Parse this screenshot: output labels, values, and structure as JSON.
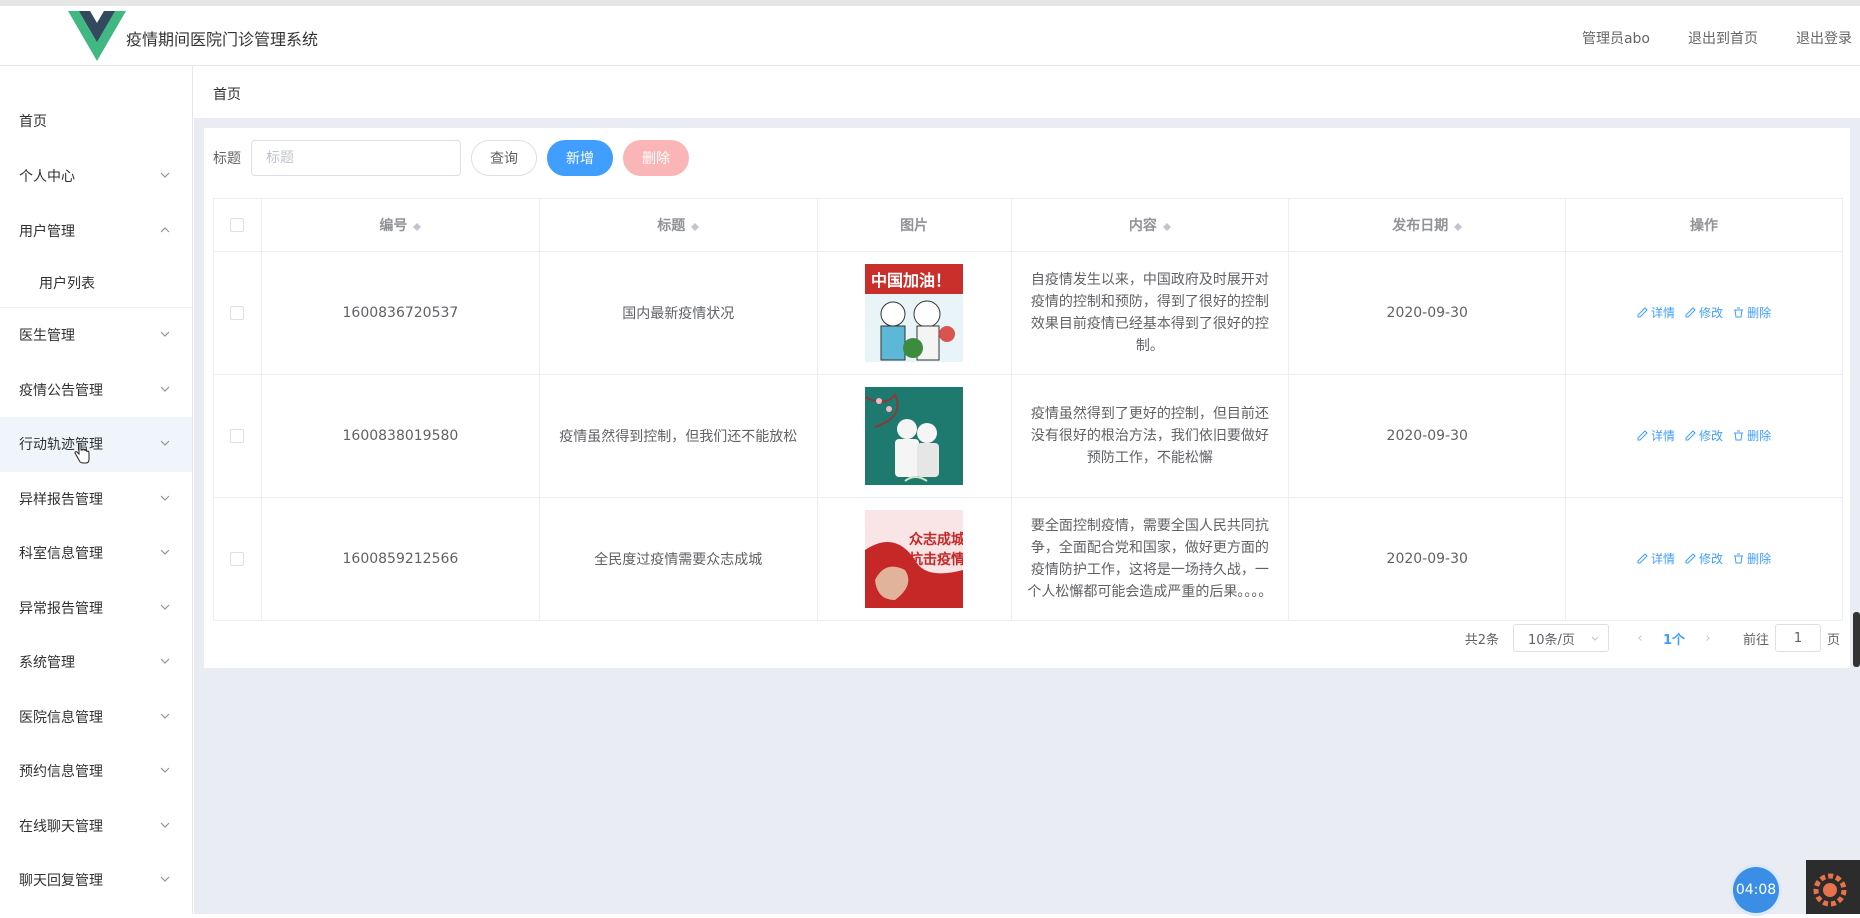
{
  "header": {
    "app_title": "疫情期间医院门诊管理系统",
    "admin_label": "管理员abo",
    "back_home": "退出到首页",
    "logout": "退出登录"
  },
  "sidebar": {
    "items": [
      {
        "label": "首页",
        "expandable": false
      },
      {
        "label": "个人中心",
        "expandable": true
      },
      {
        "label": "用户管理",
        "expandable": true,
        "expanded": true,
        "children": [
          "用户列表"
        ]
      },
      {
        "label": "医生管理",
        "expandable": true
      },
      {
        "label": "疫情公告管理",
        "expandable": true
      },
      {
        "label": "行动轨迹管理",
        "expandable": true,
        "hovered": true
      },
      {
        "label": "异样报告管理",
        "expandable": true
      },
      {
        "label": "科室信息管理",
        "expandable": true
      },
      {
        "label": "异常报告管理",
        "expandable": true
      },
      {
        "label": "系统管理",
        "expandable": true
      },
      {
        "label": "医院信息管理",
        "expandable": true
      },
      {
        "label": "预约信息管理",
        "expandable": true
      },
      {
        "label": "在线聊天管理",
        "expandable": true
      },
      {
        "label": "聊天回复管理",
        "expandable": true
      }
    ]
  },
  "breadcrumb": "首页",
  "toolbar": {
    "title_label": "标题",
    "search_placeholder": "标题",
    "search_value": "",
    "query_button": "查询",
    "add_button": "新增",
    "delete_button": "删除"
  },
  "table": {
    "columns": [
      "编号",
      "标题",
      "图片",
      "内容",
      "发布日期",
      "操作"
    ],
    "rows": [
      {
        "id": "1600836720537",
        "title": "国内最新疫情状况",
        "image": "illustration-medical-staff",
        "content": "自疫情发生以来，中国政府及时展开对疫情的控制和预防，得到了很好的控制效果目前疫情已经基本得到了很好的控制。",
        "date": "2020-09-30"
      },
      {
        "id": "1600838019580",
        "title": "疫情虽然得到控制，但我们还不能放松",
        "image": "illustration-doctors-green",
        "content": "疫情虽然得到了更好的控制，但目前还没有很好的根治方法，我们依旧要做好预防工作，不能松懈",
        "date": "2020-09-30"
      },
      {
        "id": "1600859212566",
        "title": "全民度过疫情需要众志成城",
        "image": "illustration-fist-red",
        "content": "要全面控制疫情，需要全国人民共同抗争，全面配合党和国家，做好更方面的疫情防护工作，这将是一场持久战，一个人松懈都可能会造成严重的后果。。。。",
        "date": "2020-09-30"
      }
    ],
    "actions": {
      "detail": "详情",
      "edit": "修改",
      "delete": "删除"
    }
  },
  "image_captions": {
    "img1": "中国加油！",
    "img3_line1": "众志成城",
    "img3_line2": "抗击疫情"
  },
  "pagination": {
    "total": "共2条",
    "page_size": "10条/页",
    "current_page": "1个",
    "goto_prefix": "前往",
    "goto_value": "1",
    "goto_suffix": "页"
  },
  "timer": "04:08",
  "colors": {
    "primary": "#409eff",
    "danger_disabled": "#fab6b6",
    "background": "#e9edf3"
  }
}
